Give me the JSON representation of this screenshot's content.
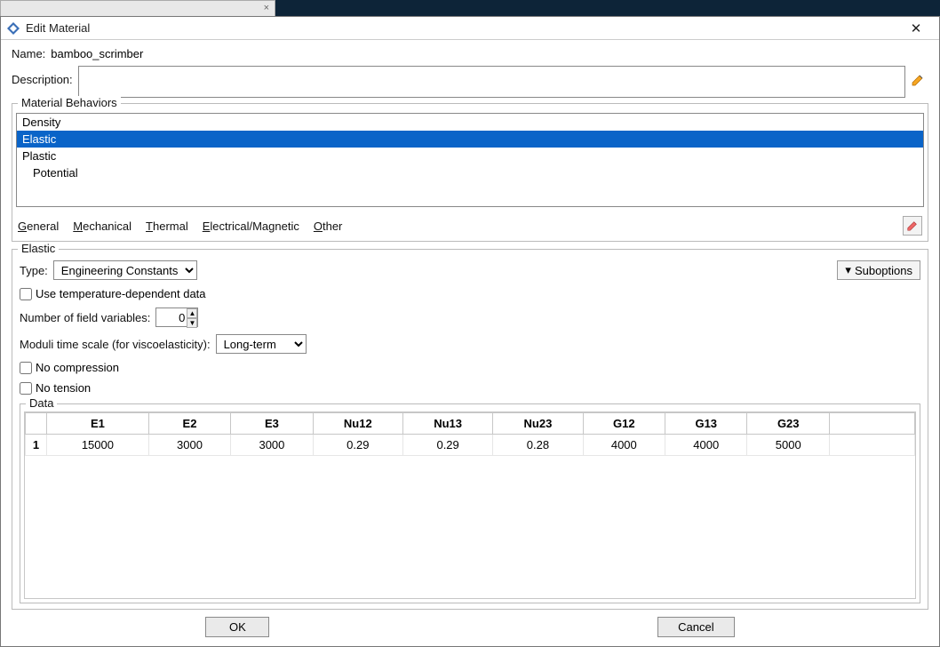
{
  "window": {
    "title": "Edit Material"
  },
  "name": {
    "label": "Name:",
    "value": "bamboo_scrimber"
  },
  "description": {
    "label": "Description:",
    "value": ""
  },
  "behaviors": {
    "legend": "Material Behaviors",
    "items": [
      {
        "label": "Density",
        "indent": false,
        "selected": false
      },
      {
        "label": "Elastic",
        "indent": false,
        "selected": true
      },
      {
        "label": "Plastic",
        "indent": false,
        "selected": false
      },
      {
        "label": "Potential",
        "indent": true,
        "selected": false
      }
    ],
    "menus": {
      "general": "General",
      "mechanical": "Mechanical",
      "thermal": "Thermal",
      "elecmag": "Electrical/Magnetic",
      "other": "Other"
    }
  },
  "elastic": {
    "legend": "Elastic",
    "type_label": "Type:",
    "type_value": "Engineering Constants",
    "suboptions_label": "Suboptions",
    "use_temp_label": "Use temperature-dependent data",
    "use_temp_checked": false,
    "field_vars_label": "Number of field variables:",
    "field_vars_value": "0",
    "moduli_label": "Moduli time scale (for viscoelasticity):",
    "moduli_value": "Long-term",
    "no_compression_label": "No compression",
    "no_compression_checked": false,
    "no_tension_label": "No tension",
    "no_tension_checked": false
  },
  "data_table": {
    "legend": "Data",
    "headers": [
      "E1",
      "E2",
      "E3",
      "Nu12",
      "Nu13",
      "Nu23",
      "G12",
      "G13",
      "G23"
    ],
    "rows": [
      {
        "n": "1",
        "cells": [
          "15000",
          "3000",
          "3000",
          "0.29",
          "0.29",
          "0.28",
          "4000",
          "4000",
          "5000"
        ]
      }
    ]
  },
  "buttons": {
    "ok": "OK",
    "cancel": "Cancel"
  }
}
